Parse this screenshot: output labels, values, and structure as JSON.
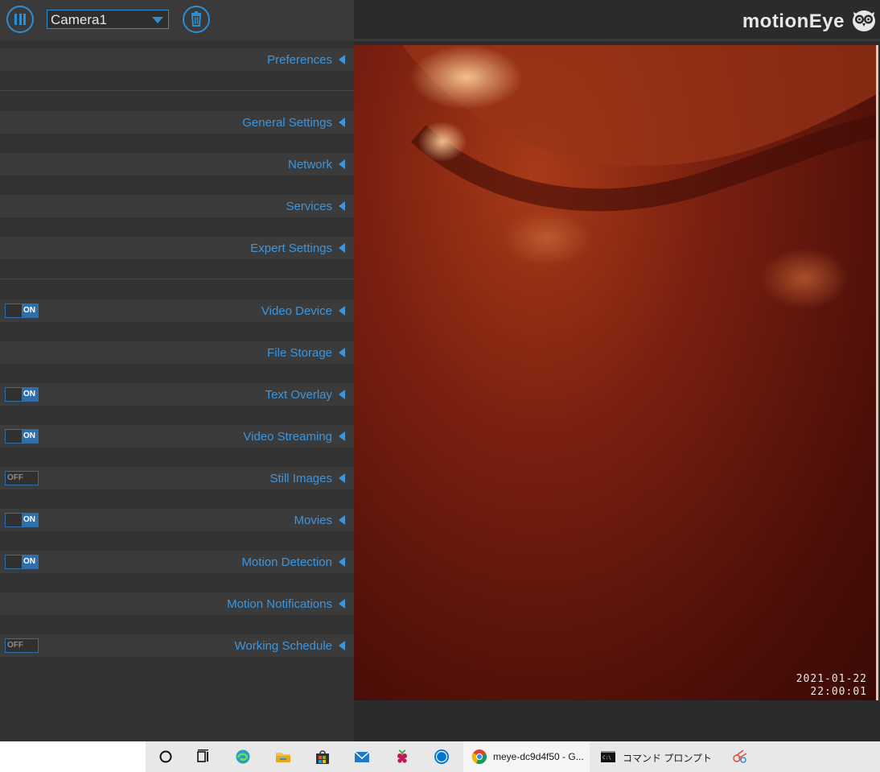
{
  "header": {
    "camera_select_value": "Camera1",
    "brand": "motionEye"
  },
  "sections": {
    "preferences": "Preferences",
    "general_settings": "General Settings",
    "network": "Network",
    "services": "Services",
    "expert_settings": "Expert Settings",
    "video_device": "Video Device",
    "file_storage": "File Storage",
    "text_overlay": "Text Overlay",
    "video_streaming": "Video Streaming",
    "still_images": "Still Images",
    "movies": "Movies",
    "motion_detection": "Motion Detection",
    "motion_notifications": "Motion Notifications",
    "working_schedule": "Working Schedule"
  },
  "toggles": {
    "video_device": "ON",
    "text_overlay": "ON",
    "video_streaming": "ON",
    "still_images": "OFF",
    "movies": "ON",
    "motion_detection": "ON",
    "working_schedule": "OFF"
  },
  "camera": {
    "timestamp_date": "2021-01-22",
    "timestamp_time": "22:00:01"
  },
  "taskbar": {
    "chrome_window": "meye-dc9d4f50 - G...",
    "cmd_window": "コマンド プロンプト",
    "icons": [
      "cortana-icon",
      "task-view-icon",
      "edge-icon",
      "file-explorer-icon",
      "store-icon",
      "mail-icon",
      "raspberry-pi-icon",
      "dell-icon",
      "chrome-icon",
      "command-prompt-icon",
      "snipping-tool-icon"
    ]
  },
  "colors": {
    "accent": "#3d95dd",
    "panel": "#333333",
    "row": "#3b3b3b",
    "toggle_on": "#2f6ea8"
  }
}
